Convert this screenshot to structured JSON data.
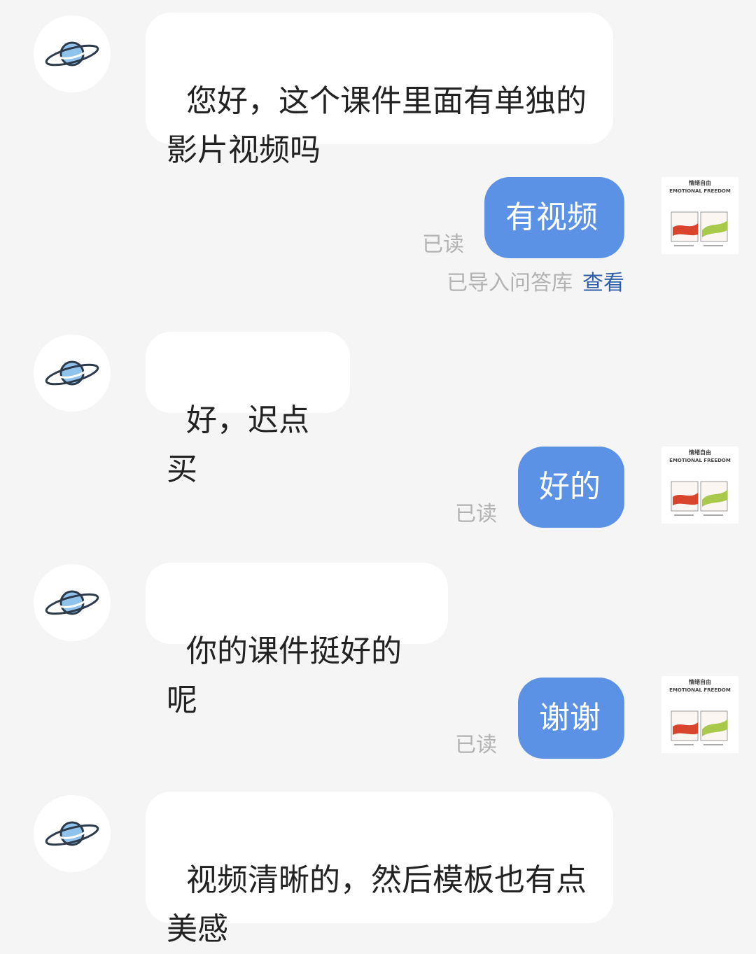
{
  "messages": [
    {
      "side": "in",
      "text": "您好，这个课件里面有单独的\n影片视频吗"
    },
    {
      "side": "out",
      "text": "有视频",
      "status": "已读",
      "imported": "已导入问答库",
      "view_link": "查看"
    },
    {
      "side": "in",
      "text": "好，迟点买"
    },
    {
      "side": "out",
      "text": "好的",
      "status": "已读"
    },
    {
      "side": "in",
      "text": "你的课件挺好的呢"
    },
    {
      "side": "out",
      "text": "谢谢",
      "status": "已读"
    },
    {
      "side": "in",
      "text": "视频清晰的，然后模板也有点\n美感"
    }
  ],
  "self_avatar": {
    "title": "情绪自由",
    "subtitle": "EMOTIONAL FREEDOM"
  },
  "colors": {
    "background": "#f5f5f5",
    "incoming_bubble": "#ffffff",
    "outgoing_bubble": "#5b92e5",
    "read_status": "#b2b2b2",
    "link": "#2e5fa8",
    "planet": "#8fc3ec"
  },
  "icons": {
    "contact_avatar": "planet-icon"
  }
}
